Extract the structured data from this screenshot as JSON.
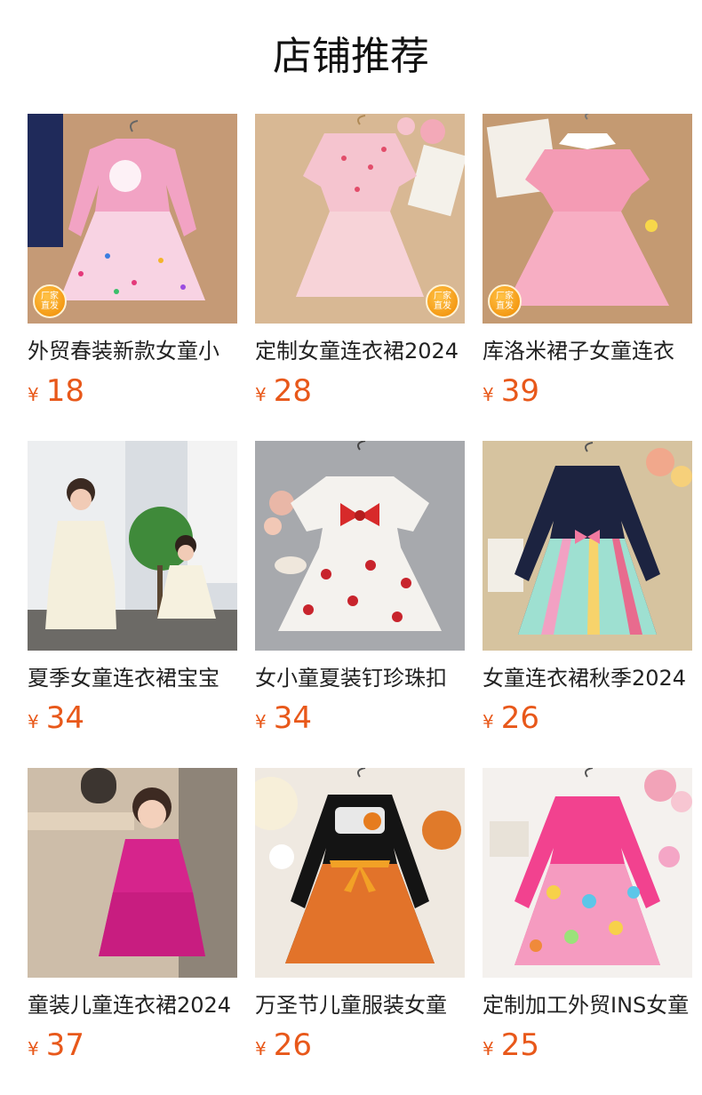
{
  "page": {
    "title": "店铺推荐"
  },
  "badge_text": {
    "line1": "厂家",
    "line2": "直发"
  },
  "currency_symbol": "¥",
  "colors": {
    "price": "#e8581a",
    "badge": "#f59a0c",
    "title": "#111111"
  },
  "products": [
    {
      "name": "外贸春装新款女童小",
      "price": "18",
      "badge": true
    },
    {
      "name": "定制女童连衣裙2024",
      "price": "28",
      "badge": true
    },
    {
      "name": "库洛米裙子女童连衣",
      "price": "39",
      "badge": true
    },
    {
      "name": "夏季女童连衣裙宝宝",
      "price": "34",
      "badge": false
    },
    {
      "name": "女小童夏装钉珍珠扣",
      "price": "34",
      "badge": false
    },
    {
      "name": "女童连衣裙秋季2024",
      "price": "26",
      "badge": false
    },
    {
      "name": "童装儿童连衣裙2024",
      "price": "37",
      "badge": false
    },
    {
      "name": "万圣节儿童服装女童",
      "price": "26",
      "badge": false
    },
    {
      "name": "定制加工外贸INS女童",
      "price": "25",
      "badge": false
    }
  ]
}
